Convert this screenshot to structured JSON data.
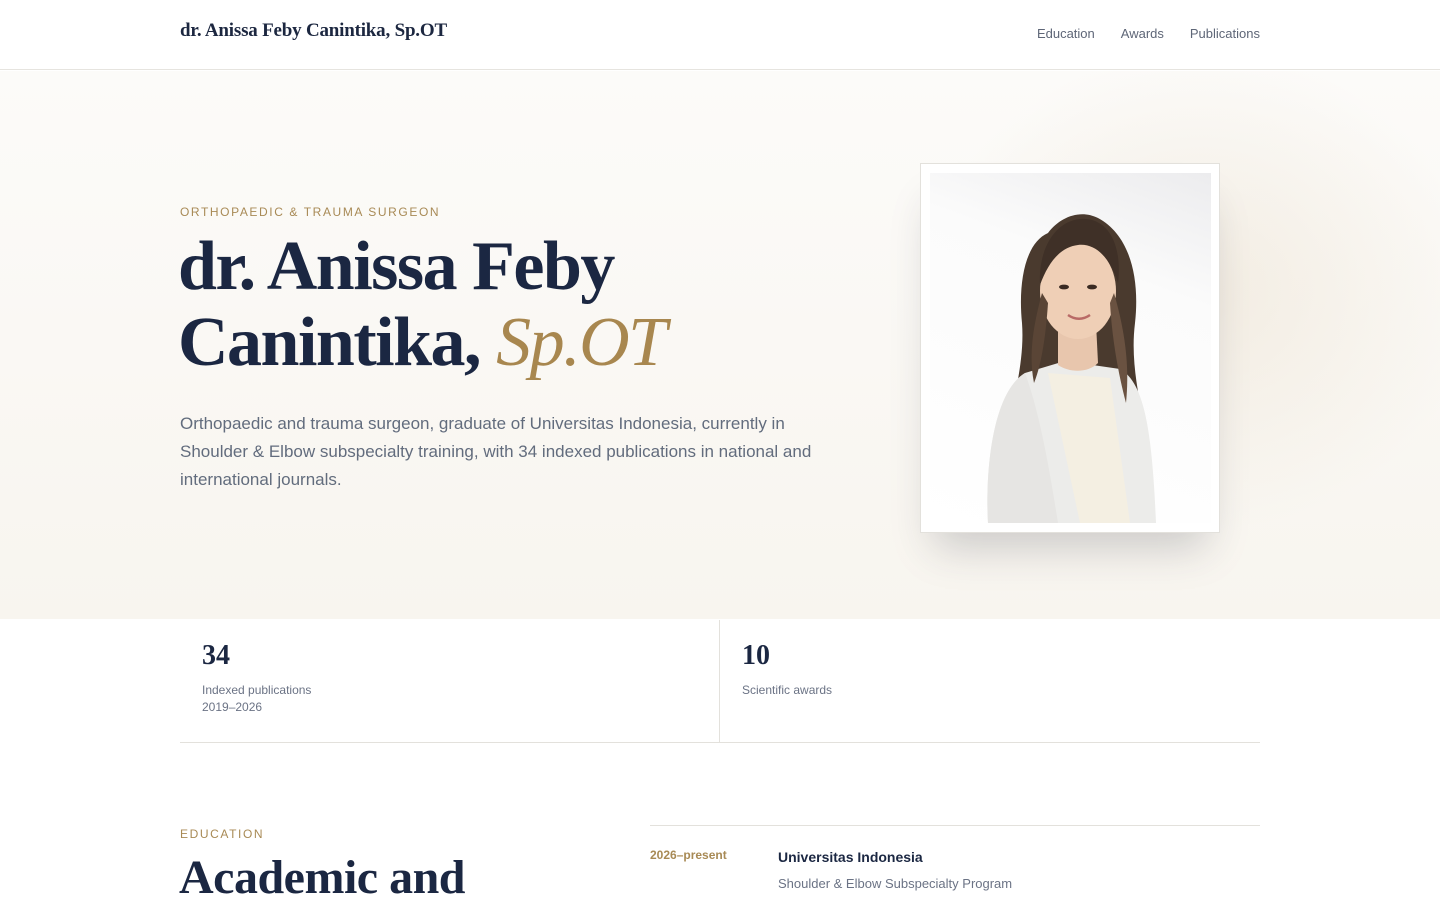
{
  "header": {
    "brand": "dr. Anissa Feby Canintika, Sp.OT",
    "nav": [
      "Education",
      "Awards",
      "Publications"
    ]
  },
  "hero": {
    "eyebrow": "ORTHOPAEDIC & TRAUMA SURGEON",
    "title_line1": "dr. Anissa Feby",
    "title_line2": "Canintika,",
    "title_accent": "Sp.OT",
    "description": "Orthopaedic and trauma surgeon, graduate of Universitas Indonesia, currently in Shoulder & Elbow subspecialty training, with 34 indexed publications in national and international journals."
  },
  "stats": [
    {
      "value": "34",
      "label": "Indexed publications",
      "sublabel": "2019–2026"
    },
    {
      "value": "10",
      "label": "Scientific awards"
    }
  ],
  "education": {
    "eyebrow": "EDUCATION",
    "title": "Academic and",
    "items": [
      {
        "period": "2026–present",
        "institution": "Universitas Indonesia",
        "program": "Shoulder & Elbow Subspecialty Program"
      }
    ]
  },
  "colors": {
    "navy": "#1b2742",
    "gold": "#a8874f",
    "muted": "#626c7d",
    "hero_bg": "#f8f5ef"
  }
}
